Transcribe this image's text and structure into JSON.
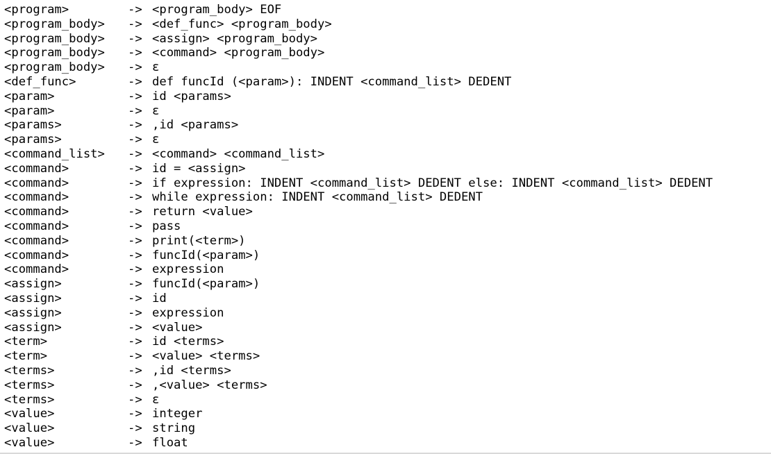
{
  "grammar": {
    "arrow": "->",
    "rules": [
      {
        "lhs": "<program>",
        "rhs": "<program_body> EOF"
      },
      {
        "lhs": "<program_body>",
        "rhs": "<def_func> <program_body>"
      },
      {
        "lhs": "<program_body>",
        "rhs": "<assign> <program_body>"
      },
      {
        "lhs": "<program_body>",
        "rhs": "<command> <program_body>"
      },
      {
        "lhs": "<program_body>",
        "rhs": "ε"
      },
      {
        "lhs": "<def_func>",
        "rhs": "def funcId (<param>): INDENT <command_list> DEDENT"
      },
      {
        "lhs": "<param>",
        "rhs": "id <params>"
      },
      {
        "lhs": "<param>",
        "rhs": "ε"
      },
      {
        "lhs": "<params>",
        "rhs": ",id <params>"
      },
      {
        "lhs": "<params>",
        "rhs": "ε"
      },
      {
        "lhs": "<command_list>",
        "rhs": "<command> <command_list>"
      },
      {
        "lhs": "<command>",
        "rhs": "id = <assign>"
      },
      {
        "lhs": "<command>",
        "rhs": "if expression: INDENT <command_list> DEDENT else: INDENT <command_list> DEDENT"
      },
      {
        "lhs": "<command>",
        "rhs": "while expression: INDENT <command_list> DEDENT"
      },
      {
        "lhs": "<command>",
        "rhs": "return <value>"
      },
      {
        "lhs": "<command>",
        "rhs": "pass"
      },
      {
        "lhs": "<command>",
        "rhs": "print(<term>)"
      },
      {
        "lhs": "<command>",
        "rhs": "funcId(<param>)"
      },
      {
        "lhs": "<command>",
        "rhs": "expression"
      },
      {
        "lhs": "<assign>",
        "rhs": "funcId(<param>)"
      },
      {
        "lhs": "<assign>",
        "rhs": "id"
      },
      {
        "lhs": "<assign>",
        "rhs": "expression"
      },
      {
        "lhs": "<assign>",
        "rhs": "<value>"
      },
      {
        "lhs": "<term>",
        "rhs": "id <terms>"
      },
      {
        "lhs": "<term>",
        "rhs": "<value> <terms>"
      },
      {
        "lhs": "<terms>",
        "rhs": ",id <terms>"
      },
      {
        "lhs": "<terms>",
        "rhs": ",<value> <terms>"
      },
      {
        "lhs": "<terms>",
        "rhs": "ε"
      },
      {
        "lhs": "<value>",
        "rhs": "integer"
      },
      {
        "lhs": "<value>",
        "rhs": "string"
      },
      {
        "lhs": "<value>",
        "rhs": "float"
      }
    ]
  }
}
